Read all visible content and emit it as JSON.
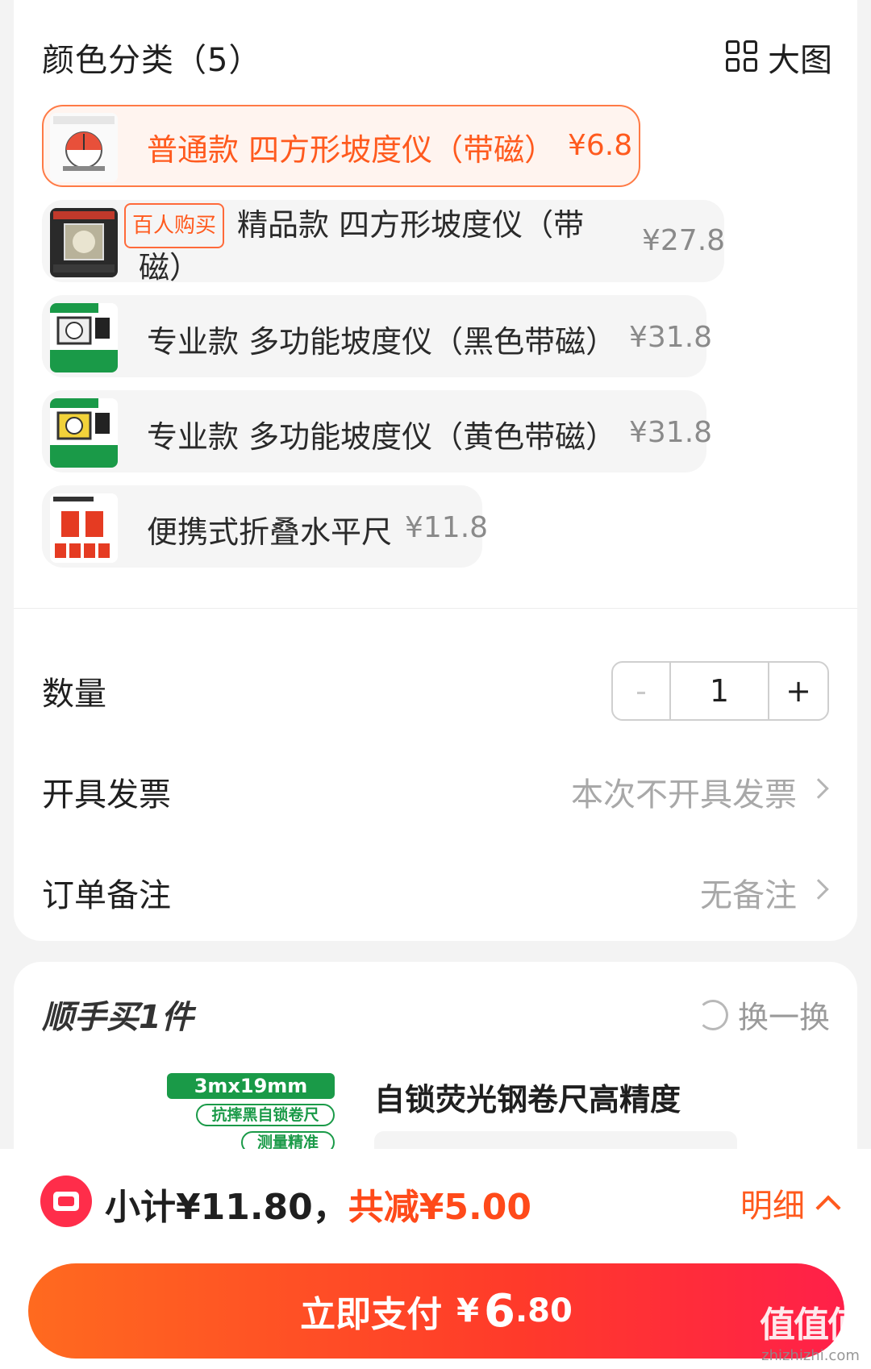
{
  "section": {
    "title": "颜色分类（5）",
    "bigview_label": "大图"
  },
  "variants": [
    {
      "name": "普通款 四方形坡度仪（带磁）",
      "price": "¥6.8",
      "selected": true
    },
    {
      "tag": "百人购买",
      "name_line1": "精品款 四方形坡度仪（带",
      "name_line2": "磁）",
      "price": "¥27.8"
    },
    {
      "name": "专业款 多功能坡度仪（黑色带磁）",
      "price": "¥31.8"
    },
    {
      "name": "专业款 多功能坡度仪（黄色带磁）",
      "price": "¥31.8"
    },
    {
      "name": "便携式折叠水平尺",
      "price": "¥11.8"
    }
  ],
  "quantity": {
    "label": "数量",
    "minus": "-",
    "value": "1",
    "plus": "+"
  },
  "invoice": {
    "label": "开具发票",
    "value": "本次不开具发票"
  },
  "remark": {
    "label": "订单备注",
    "value": "无备注"
  },
  "addon": {
    "title": "顺手买1件",
    "swap_label": "换一换",
    "product_name": "自锁荧光钢卷尺高精度",
    "badge1": "3mx19mm",
    "badge2": "抗摔黑自锁卷尺",
    "badge3": "测量精准"
  },
  "footer": {
    "subtotal_prefix": "小计¥11.80，",
    "discount": "共减¥5.00",
    "detail_label": "明细",
    "pay_label": "立即支付",
    "pay_currency": "¥",
    "pay_int": "6",
    "pay_dec": ".80"
  },
  "watermark": {
    "main": "值值值",
    "sub": "zhizhizhi.com"
  },
  "colors": {
    "accent": "#ff5a1e",
    "pay_gradient_start": "#ff6a1f",
    "pay_gradient_end": "#ff2049",
    "badge_green": "#1a9a48"
  }
}
